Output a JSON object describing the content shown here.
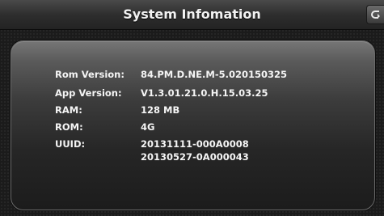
{
  "header": {
    "title": "System Infomation"
  },
  "info": [
    {
      "label": "Rom Version:",
      "value": "84.PM.D.NE.M-5.020150325"
    },
    {
      "label": "App Version:",
      "value": "V1.3.01.21.0.H.15.03.25"
    },
    {
      "label": "RAM:",
      "value": "128 MB"
    },
    {
      "label": "ROM:",
      "value": "4G"
    },
    {
      "label": "UUID:",
      "values": [
        "20131111-000A0008",
        "20130527-0A000043"
      ]
    }
  ],
  "icons": {
    "back": "back-arrow-icon"
  }
}
